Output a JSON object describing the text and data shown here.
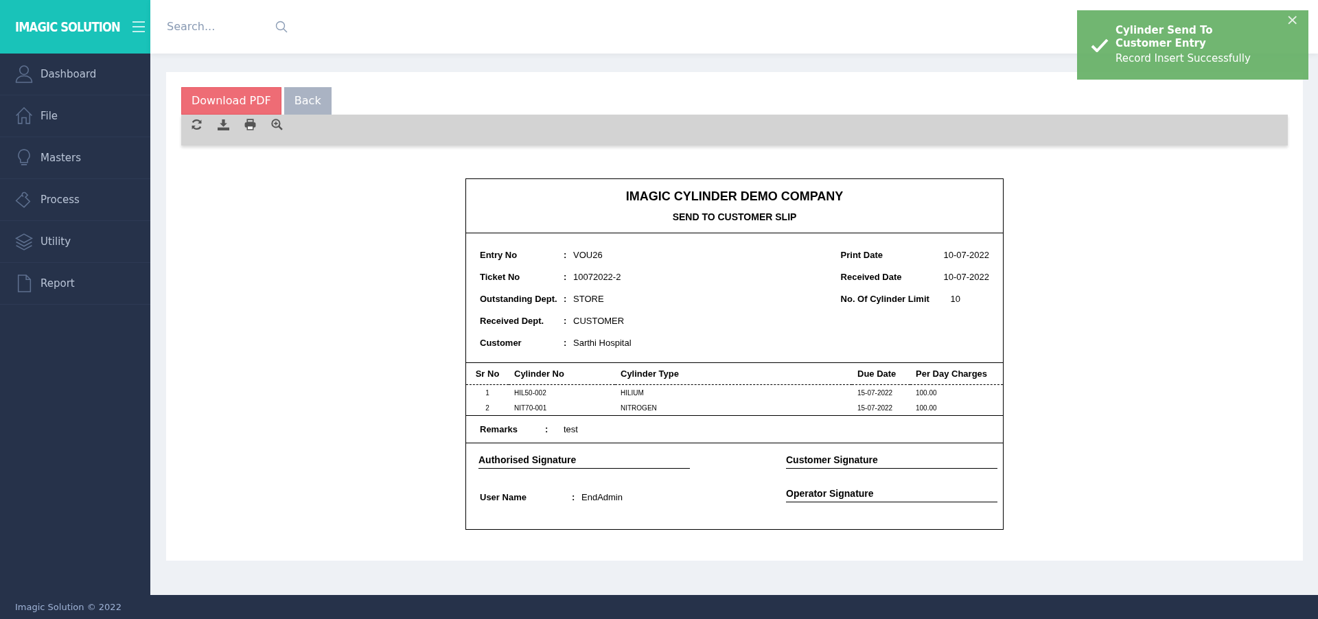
{
  "brand": {
    "title": "IMAGIC SOLUTION"
  },
  "search": {
    "placeholder": "Search..."
  },
  "sidebar": {
    "items": [
      {
        "label": "Dashboard"
      },
      {
        "label": "File"
      },
      {
        "label": "Masters"
      },
      {
        "label": "Process"
      },
      {
        "label": "Utility"
      },
      {
        "label": "Report"
      }
    ]
  },
  "toast": {
    "title": "Cylinder Send To Customer Entry",
    "message": "Record Insert Successfully",
    "close": "×"
  },
  "buttons": [
    {
      "label": "Download PDF",
      "kind": "danger"
    },
    {
      "label": "Back",
      "kind": "secondary"
    }
  ],
  "slip": {
    "company": "IMAGIC CYLINDER DEMO COMPANY",
    "title": "SEND TO CUSTOMER SLIP",
    "fields_left": [
      {
        "label": "Entry No",
        "separator": ":",
        "value": "VOU26"
      },
      {
        "label": "Ticket No",
        "separator": ":",
        "value": "10072022-2"
      },
      {
        "label": "Outstanding Dept.",
        "separator": ":",
        "value": "STORE"
      },
      {
        "label": "Received Dept.",
        "separator": ":",
        "value": "CUSTOMER"
      },
      {
        "label": "Customer",
        "separator": ":",
        "value": "Sarthi Hospital"
      }
    ],
    "fields_right": [
      {
        "label": "Print Date",
        "value": "10-07-2022"
      },
      {
        "label": "Received Date",
        "value": "10-07-2022"
      },
      {
        "label": "No. Of Cylinder Limit",
        "value": "10"
      }
    ],
    "table": {
      "columns": [
        "Sr No",
        "Cylinder No",
        "Cylinder Type",
        "Due Date",
        "Per Day Charges"
      ],
      "rows": [
        [
          "1",
          "HIL50-002",
          "HILIUM",
          "15-07-2022",
          "100.00"
        ],
        [
          "2",
          "NIT70-001",
          "NITROGEN",
          "15-07-2022",
          "100.00"
        ]
      ]
    },
    "remarks": {
      "label": "Remarks",
      "separator": ":",
      "value": "test"
    },
    "authorised_signature": {
      "label": "Authorised Signature"
    },
    "user_name": {
      "label": "User Name",
      "separator": ":",
      "value": "EndAdmin"
    },
    "customer_signature": {
      "label": "Customer Signature"
    },
    "operator_signature": {
      "label": "Operator Signature"
    }
  },
  "footer": {
    "text": "Imagic Solution © 2022"
  }
}
